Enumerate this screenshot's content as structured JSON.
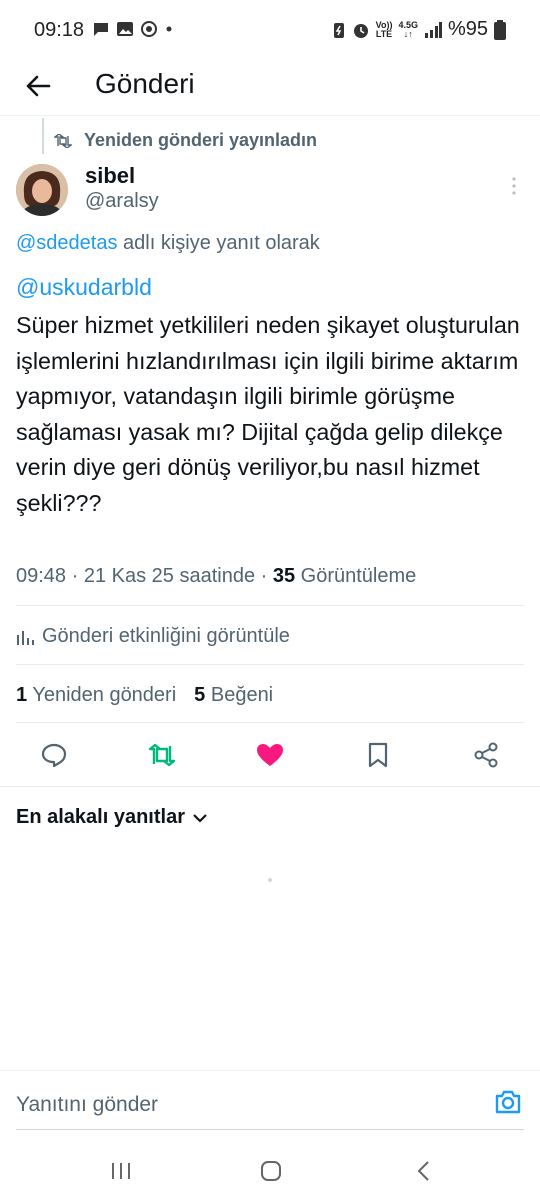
{
  "status_bar": {
    "time": "09:18",
    "net_top": "Vo))",
    "net_bottom": "LTE",
    "net2_top": "4.5G",
    "net2_bottom": "↓↑",
    "battery": "%95"
  },
  "header": {
    "title": "Gönderi"
  },
  "repost": {
    "label": "Yeniden gönderi yayınladın"
  },
  "author": {
    "name": "sibel",
    "handle": "@aralsy"
  },
  "reply_to": {
    "handle": "@sdedetas",
    "suffix": " adlı kişiye yanıt olarak"
  },
  "post": {
    "mention": "@uskudarbld",
    "text": "Süper hizmet yetkilileri neden şikayet oluşturulan işlemlerini hızlandırılması için ilgili birime aktarım yapmıyor, vatandaşın ilgili birimle görüşme sağlaması yasak mı? Dijital çağda gelip dilekçe verin diye geri dönüş veriliyor,bu nasıl hizmet şekli???",
    "time": "09:48 · 21 Kas 25 saatinde · ",
    "views": "35",
    "views_label": " Görüntüleme"
  },
  "activity": {
    "label": "Gönderi etkinliğini görüntüle"
  },
  "stats": {
    "reposts_count": "1",
    "reposts_label": " Yeniden gönderi",
    "likes_count": "5",
    "likes_label": " Beğeni"
  },
  "actions": {
    "reply_icon": "reply-icon",
    "repost_icon": "repost-icon",
    "like_icon": "heart-icon",
    "bookmark_icon": "bookmark-icon",
    "share_icon": "share-icon",
    "repost_color": "#00ba7c",
    "like_color": "#f91880"
  },
  "replies": {
    "sort_label": "En alakalı yanıtlar"
  },
  "composer": {
    "placeholder": "Yanıtını gönder"
  },
  "colors": {
    "accent": "#1d9bf0",
    "secondary_text": "#536471"
  }
}
